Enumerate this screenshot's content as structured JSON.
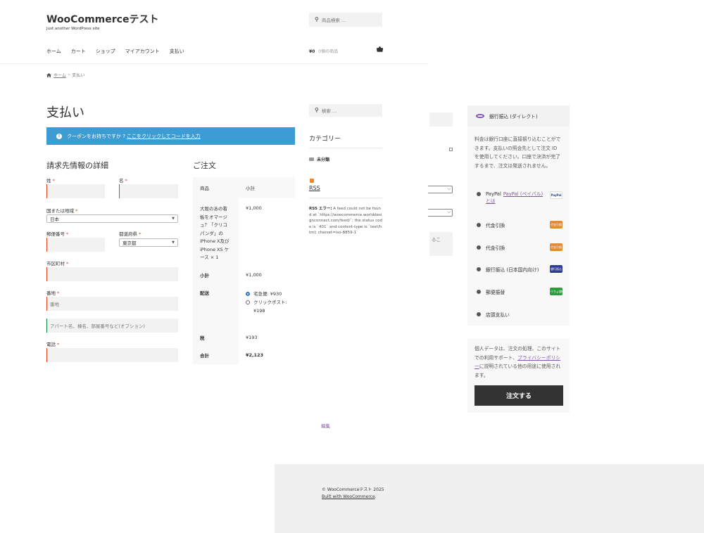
{
  "header": {
    "site_title": "WooCommerceテスト",
    "tagline": "Just another WordPress site",
    "search_placeholder": "商品検索 …",
    "nav": [
      "ホーム",
      "カート",
      "ショップ",
      "マイアカウント",
      "支払い"
    ],
    "cart_amount": "¥0",
    "cart_count": "0個の商品"
  },
  "breadcrumb": {
    "home": "ホーム",
    "sep": "›",
    "current": "支払い"
  },
  "page_title": "支払い",
  "coupon": {
    "text": "クーポンをお持ちですか ?",
    "link": "ここをクリックしてコードを入力"
  },
  "billing": {
    "title": "請求先情報の詳細",
    "last_name": "姓",
    "first_name": "名",
    "country_label": "国または地域",
    "country_value": "日本",
    "postcode_label": "郵便番号",
    "state_label": "都道府県",
    "state_value": "東京都",
    "city_label": "市区町村",
    "address_label": "番地",
    "address_placeholder": "番地",
    "address2_placeholder": "アパート名、棟名、部屋番号など(オプション)",
    "phone_label": "電話",
    "req": "*"
  },
  "order": {
    "title": "ご注文",
    "col_product": "商品",
    "col_subtotal": "小計",
    "product_name": "大阪のあの看板をオマージュ？「クリコパンダ」の iPhone X及び iPhone XS ケース × 1",
    "product_price": "¥1,000",
    "subtotal_label": "小計",
    "subtotal_value": "¥1,000",
    "shipping_label": "配送",
    "shipping_opt1": "宅急便: ¥930",
    "shipping_opt2": "クリックポスト: ¥198",
    "tax_label": "税",
    "tax_value": "¥193",
    "total_label": "合計",
    "total_value": "¥2,123"
  },
  "sidebar": {
    "search_placeholder": "検索 …",
    "category_title": "カテゴリー",
    "category_item": "未分類",
    "rss_title": "RSS",
    "rss_error_label": "RSS エラー:",
    "rss_error_text": "A feed could not be found at `https://woocommerce.worlddesignconnect.com/feed/`; the status code is `401` and content-type is `text/html; charset=iso-8859-1`"
  },
  "ghost": {
    "textarea_text": "るこ"
  },
  "payment": {
    "selected_label": "銀行振込 (ダイレクト)",
    "selected_desc": "料金は銀行口座に直接振り込むことができます。支払いの照会先として注文 ID を使用してください。口座で決済が完了するまで、注文は発送されません。",
    "paypal_label": "PayPal",
    "paypal_link": "PayPal (ペイパル) とは",
    "paypal_badge": "PayPal",
    "cod1_label": "代金引換",
    "cod2_label": "代金引換",
    "cod_badge": "代金引換",
    "jpbank_label": "銀行振込 (日本国内向け)",
    "jpbank_badge": "銀行振込",
    "postal_label": "郵便振替",
    "postal_badge": "ゆうちょ銀行",
    "store_label": "店頭支払い",
    "privacy_before": "個人データは、注文の処理、このサイトでの利用サポート、",
    "privacy_link": "プライバシーポリシー",
    "privacy_after": "に説明されている他の用途に使用されます。",
    "place_order": "注文する"
  },
  "edit_link": "編集",
  "footer": {
    "copyright": "© WooCommerceテスト 2025",
    "built_with": "Built with WooCommerce",
    "built_dot": "."
  },
  "colors": {
    "accent_purple": "#7f54b3",
    "info_blue": "#3d9cd2",
    "required_red": "#e2401c",
    "button_dark": "#333333"
  }
}
